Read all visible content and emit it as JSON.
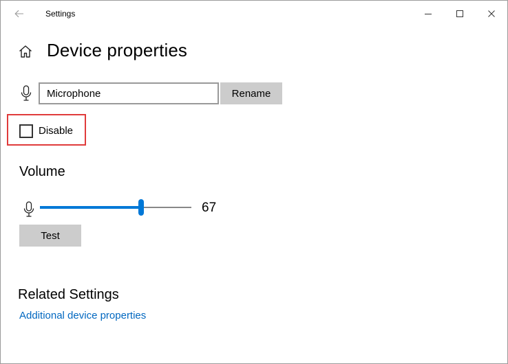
{
  "window": {
    "title": "Settings",
    "controls": [
      "minimize-icon",
      "maximize-icon",
      "close-icon"
    ]
  },
  "header": {
    "title": "Device properties",
    "home_icon": "home-icon"
  },
  "device": {
    "name_value": "Microphone",
    "rename_label": "Rename",
    "icon": "microphone-icon"
  },
  "disable": {
    "label": "Disable",
    "checked": false,
    "highlight_color": "#e03a3a"
  },
  "volume": {
    "heading": "Volume",
    "value": "67",
    "level": 67,
    "test_label": "Test",
    "accent": "#0078d7"
  },
  "related": {
    "heading": "Related Settings",
    "link": "Additional device properties",
    "link_color": "#0067c0"
  }
}
